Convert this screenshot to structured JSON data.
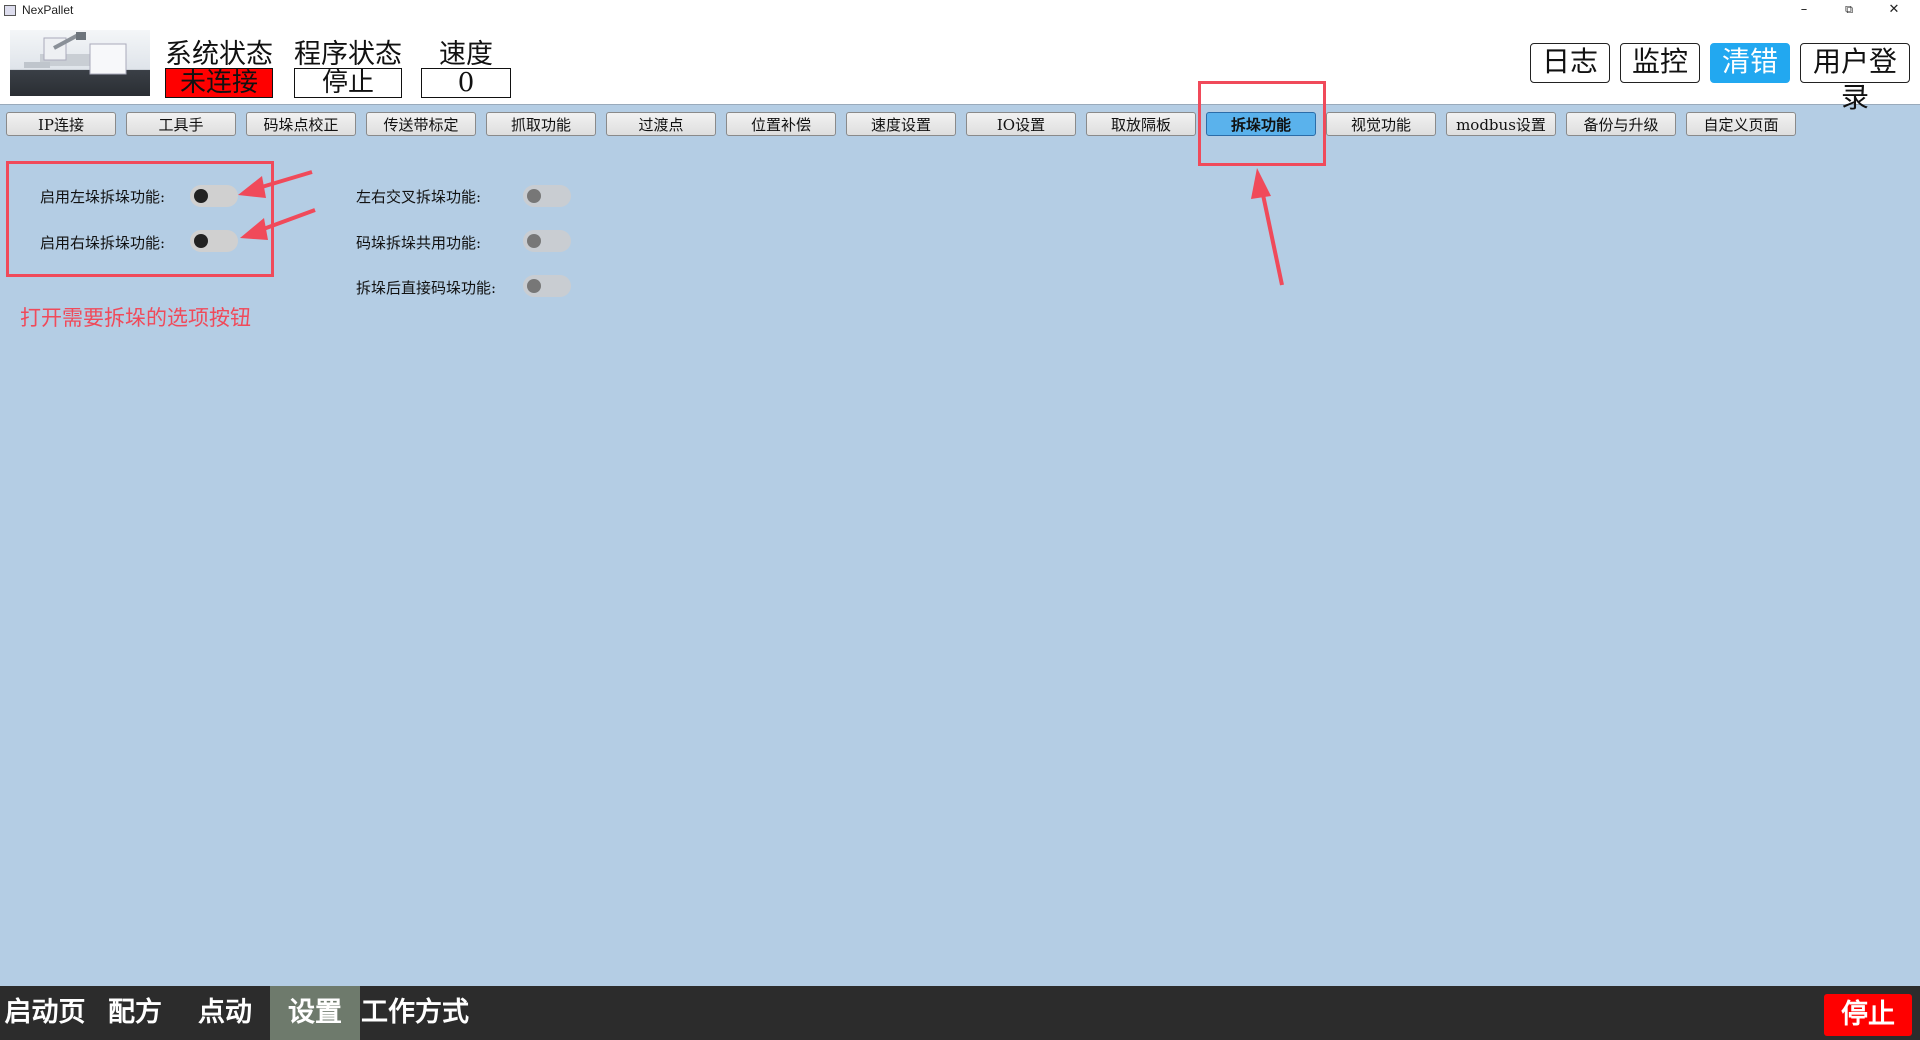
{
  "window": {
    "title": "NexPallet",
    "minimize": "–",
    "restore": "⧉",
    "close": "✕"
  },
  "header": {
    "system_status": {
      "label": "系统状态",
      "value": "未连接",
      "color": "#ff0000"
    },
    "program_status": {
      "label": "程序状态",
      "value": "停止"
    },
    "speed": {
      "label": "速度",
      "value": "0"
    },
    "buttons": {
      "log": "日志",
      "monitor": "监控",
      "clear_error": "清错",
      "user_login": "用户登录"
    },
    "accent_color": "#22a8f0"
  },
  "tabs": [
    {
      "label": "IP连接"
    },
    {
      "label": "工具手"
    },
    {
      "label": "码垛点校正"
    },
    {
      "label": "传送带标定"
    },
    {
      "label": "抓取功能"
    },
    {
      "label": "过渡点"
    },
    {
      "label": "位置补偿"
    },
    {
      "label": "速度设置"
    },
    {
      "label": "IO设置"
    },
    {
      "label": "取放隔板"
    },
    {
      "label": "拆垛功能",
      "active": true
    },
    {
      "label": "视觉功能"
    },
    {
      "label": "modbus设置"
    },
    {
      "label": "备份与升级"
    },
    {
      "label": "自定义页面"
    }
  ],
  "settings": {
    "left_unstack": {
      "label": "启用左垛拆垛功能:",
      "enabled": false
    },
    "right_unstack": {
      "label": "启用右垛拆垛功能:",
      "enabled": false
    },
    "cross_unstack": {
      "label": "左右交叉拆垛功能:",
      "enabled": false,
      "disabled": true
    },
    "shared_stack": {
      "label": "码垛拆垛共用功能:",
      "enabled": false,
      "disabled": true
    },
    "stack_after_unstack": {
      "label": "拆垛后直接码垛功能:",
      "enabled": false,
      "disabled": true
    }
  },
  "annotation": {
    "text": "打开需要拆垛的选项按钮",
    "color": "#f04a5a"
  },
  "bottom_nav": [
    {
      "label": "启动页"
    },
    {
      "label": "配方"
    },
    {
      "label": "点动"
    },
    {
      "label": "设置",
      "active": true
    },
    {
      "label": "工作方式"
    }
  ],
  "stop_button": "停止"
}
